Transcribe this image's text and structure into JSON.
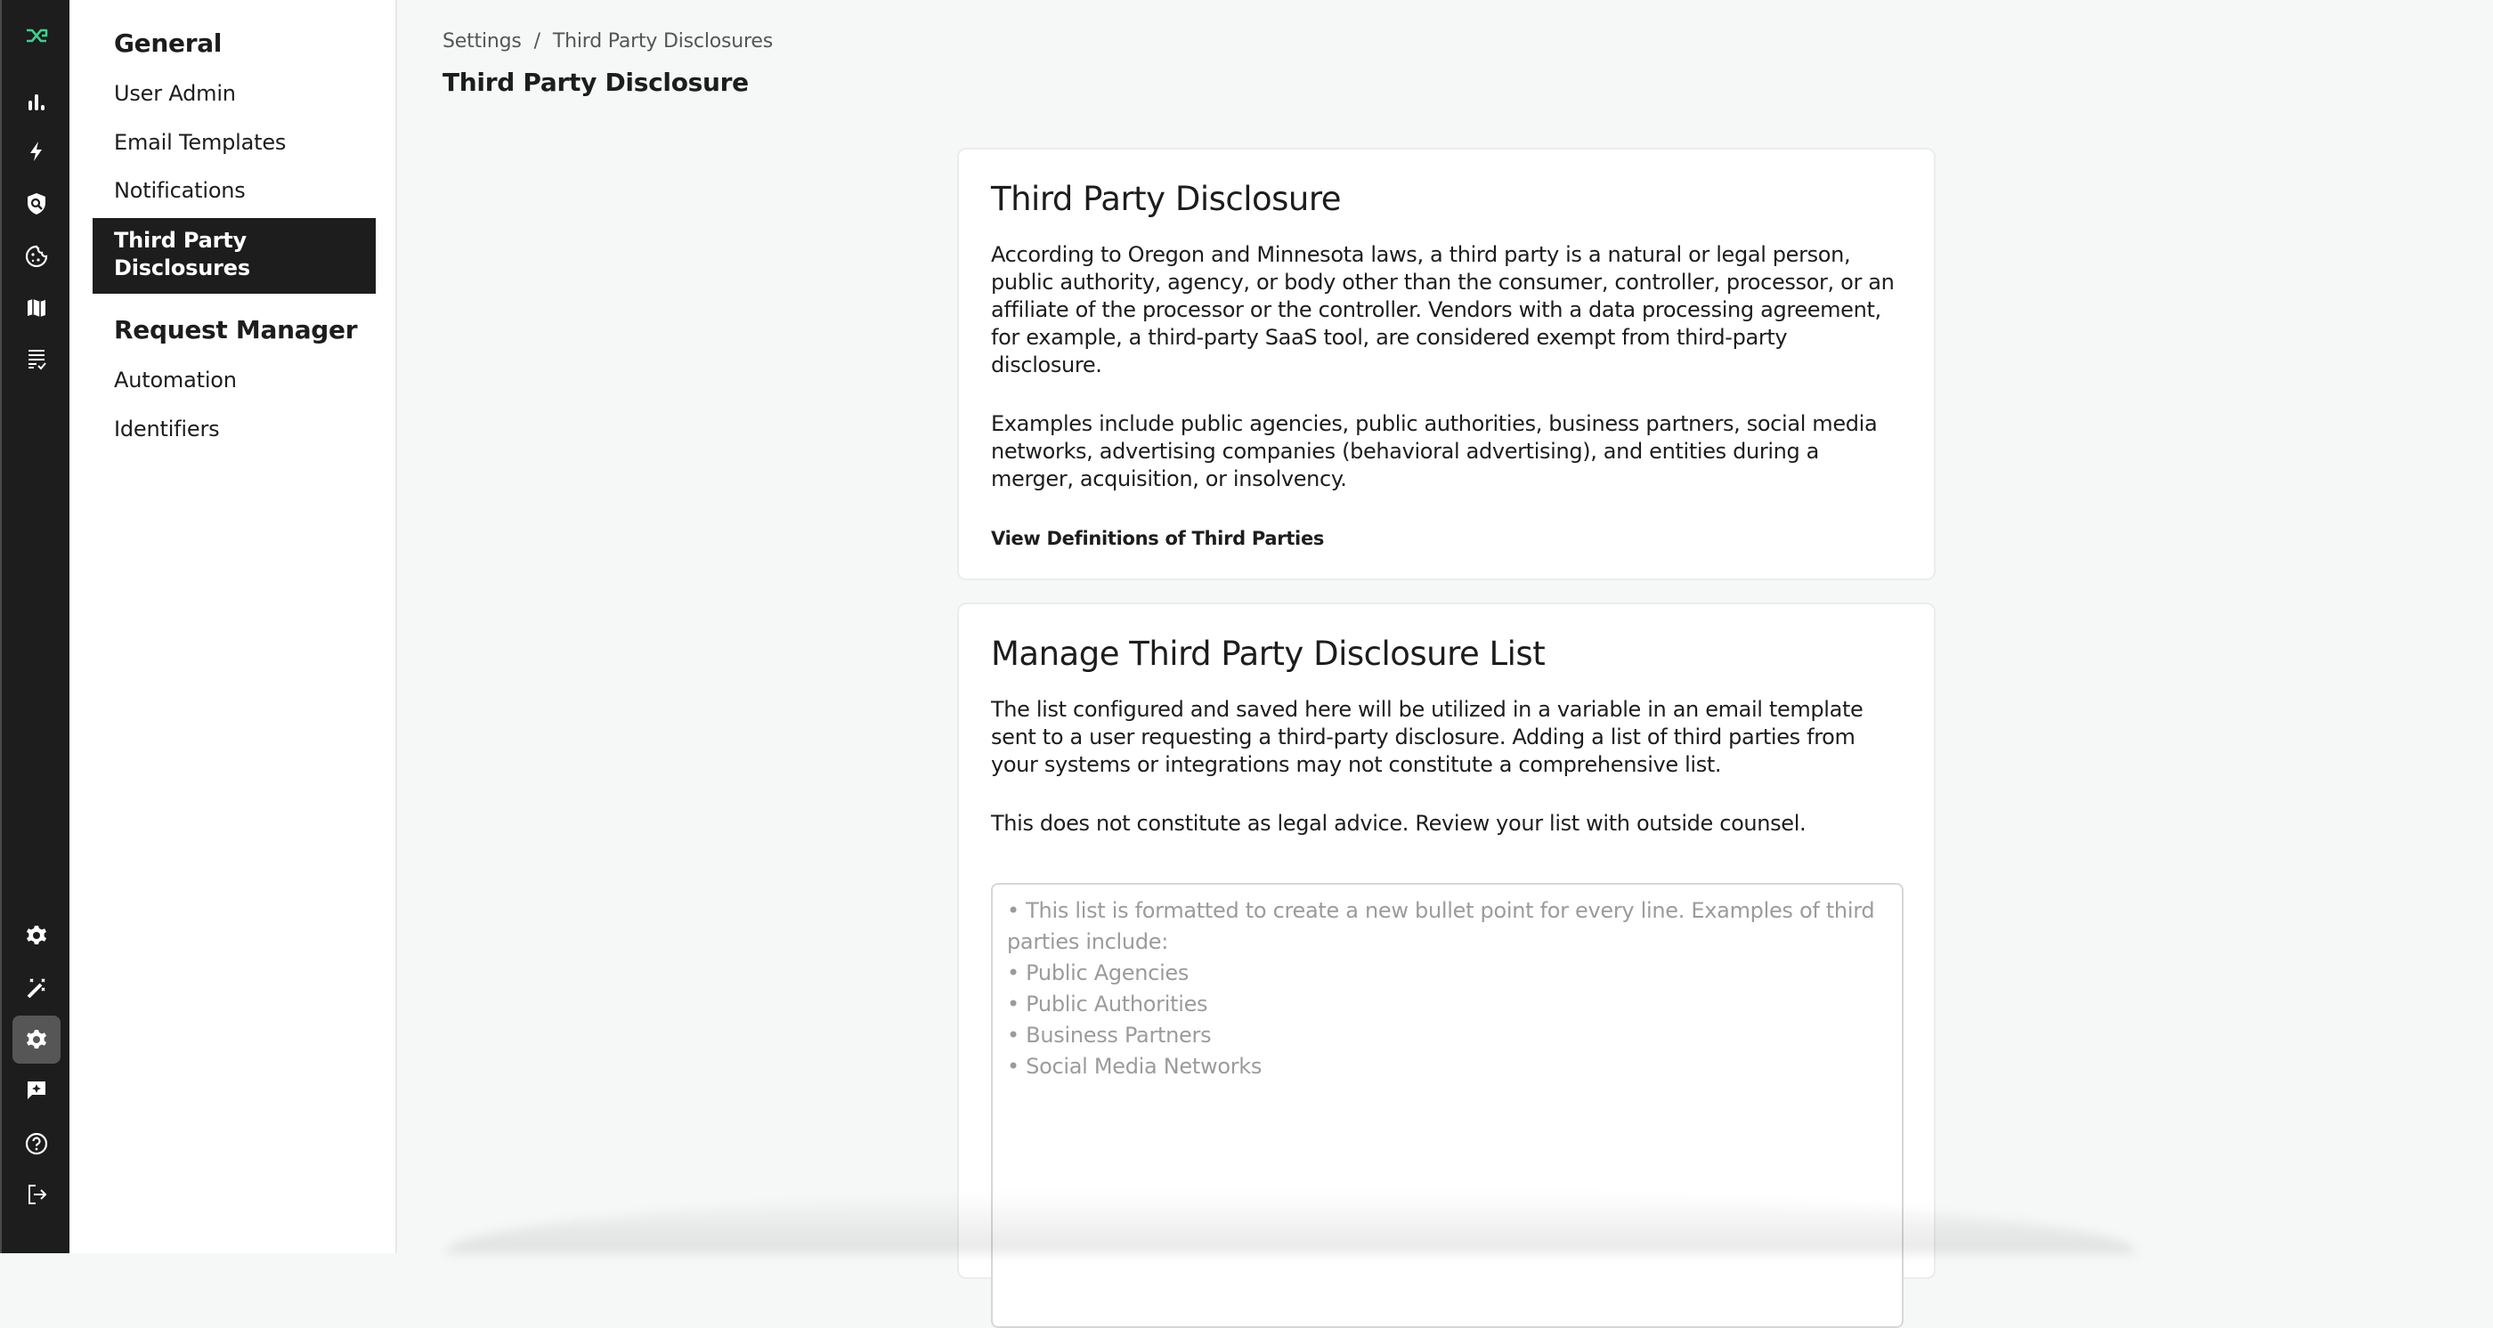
{
  "app": {
    "brand_color": "#3ecf8e",
    "logo": "dx-logo-icon"
  },
  "rail": {
    "top_items": [
      {
        "name": "dashboard",
        "icon": "bar-chart-icon"
      },
      {
        "name": "automation",
        "icon": "lightning-icon"
      },
      {
        "name": "privacy-scan",
        "icon": "shield-search-icon"
      },
      {
        "name": "consent",
        "icon": "cookie-icon"
      },
      {
        "name": "data-map",
        "icon": "map-icon"
      },
      {
        "name": "requests",
        "icon": "list-check-icon"
      }
    ],
    "bottom_items": [
      {
        "name": "settings-general",
        "icon": "gear-icon"
      },
      {
        "name": "integrations",
        "icon": "magic-wand-icon"
      },
      {
        "name": "settings",
        "icon": "gear-icon",
        "active": true
      },
      {
        "name": "feedback",
        "icon": "chat-sparkle-icon"
      },
      {
        "name": "help",
        "icon": "help-circle-icon"
      },
      {
        "name": "logout",
        "icon": "logout-icon"
      }
    ]
  },
  "subnav": {
    "sections": [
      {
        "heading": "General",
        "items": [
          "User Admin",
          "Email Templates",
          "Notifications",
          "Third Party Disclosures"
        ]
      },
      {
        "heading": "Request Manager",
        "items": [
          "Automation",
          "Identifiers"
        ]
      }
    ],
    "active_item": "Third Party Disclosures"
  },
  "header": {
    "breadcrumb": [
      "Settings",
      "Third Party Disclosures"
    ],
    "breadcrumb_sep": "/",
    "title": "Third Party Disclosure"
  },
  "card1": {
    "title": "Third Party Disclosure",
    "p1": "According to Oregon and Minnesota laws, a third party is a natural or legal person, public authority, agency, or body other than the consumer, controller, processor, or an affiliate of the processor or the controller. Vendors with a data processing agreement, for example, a third-party SaaS tool, are considered exempt from third-party disclosure.",
    "p2": "Examples include public agencies, public authorities, business partners, social media networks, advertising companies (behavioral advertising), and entities during a merger, acquisition, or insolvency.",
    "link": "View Definitions of Third Parties"
  },
  "card2": {
    "title": "Manage Third Party Disclosure List",
    "p1": "The list configured and saved here will be utilized in a variable in an email template sent to a user requesting a third-party disclosure. Adding a list of third parties from your systems or integrations may not constitute a comprehensive list.",
    "p2": "This does not constitute as legal advice. Review your list with outside counsel.",
    "textarea_value": "",
    "textarea_placeholder": "• This list is formatted to create a new bullet point for every line. Examples of third parties include:\n• Public Agencies\n• Public Authorities\n• Business Partners\n• Social Media Networks"
  }
}
